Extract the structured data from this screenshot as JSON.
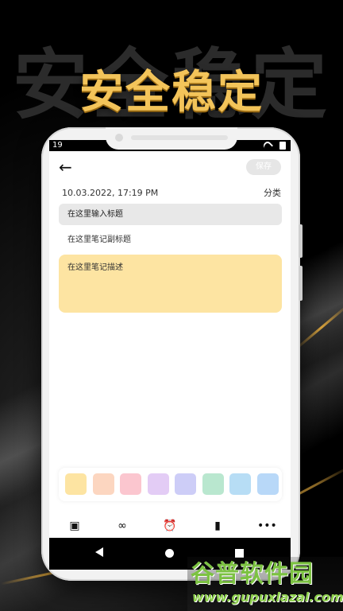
{
  "banner": {
    "headline": "安全稳定",
    "headline_shadow": "安全稳定"
  },
  "status_bar": {
    "time": "19"
  },
  "editor": {
    "save_label": "保存",
    "date": "10.03.2022, 17:19 PM",
    "category_label": "分类",
    "title_placeholder": "在这里输入标题",
    "subtitle_placeholder": "在这里笔记副标题",
    "description_placeholder": "在这里笔记描述",
    "description_color": "#fde4a2"
  },
  "color_swatches": [
    "#fde4a2",
    "#fcd6c0",
    "#fbc6cf",
    "#e3ccf5",
    "#cdcdf7",
    "#b9e7cf",
    "#b7ddf5",
    "#b8d8f8"
  ],
  "toolbar": {
    "items": [
      "add-image-icon",
      "add-link-icon",
      "alarm-icon",
      "bookmark-icon",
      "more-icon"
    ]
  },
  "watermark": {
    "title": "谷普软件园",
    "url": "www.gupuxlazal.com"
  }
}
